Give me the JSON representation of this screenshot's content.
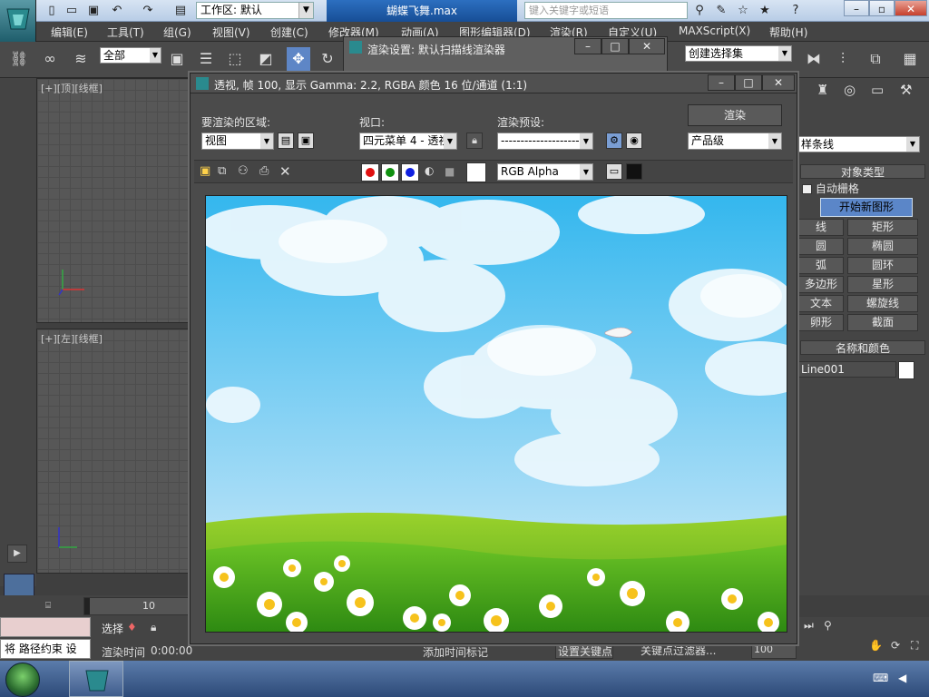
{
  "titlebar": {
    "workspace_label": "工作区: 默认",
    "doc_title": "蝴蝶飞舞.max",
    "search_placeholder": "键入关键字或短语"
  },
  "menu": [
    "编辑(E)",
    "工具(T)",
    "组(G)",
    "视图(V)",
    "创建(C)",
    "修改器(M)",
    "动画(A)",
    "图形编辑器(D)",
    "渲染(R)",
    "自定义(U)",
    "MAXScript(X)",
    "帮助(H)"
  ],
  "toolbar": {
    "selection_filter": "全部",
    "create_selection_set": "创建选择集"
  },
  "viewports": {
    "top": "[+][顶][线框]",
    "left": "[+][左][线框]"
  },
  "render_settings_title": "渲染设置: 默认扫描线渲染器",
  "frame_window": {
    "title": "透视, 帧 100, 显示 Gamma: 2.2, RGBA 颜色 16 位/通道 (1:1)",
    "area_label": "要渲染的区域:",
    "area_value": "视图",
    "viewport_label": "视口:",
    "viewport_value": "四元菜单 4 - 透视",
    "preset_label": "渲染预设:",
    "preset_value": "--------------------",
    "render_button": "渲染",
    "quality_value": "产品级",
    "channel_value": "RGB Alpha",
    "channel_colors": {
      "red": "#e01010",
      "green": "#109010",
      "blue": "#1020e0"
    }
  },
  "cmd_panel": {
    "category": "样条线",
    "object_type_header": "对象类型",
    "autogrid": "自动栅格",
    "start_new_shape": "开始新图形",
    "buttons": [
      "线",
      "矩形",
      "圆",
      "椭圆",
      "弧",
      "圆环",
      "多边形",
      "星形",
      "文本",
      "螺旋线",
      "卵形",
      "截面"
    ],
    "name_color_header": "名称和颜色",
    "object_name": "Line001"
  },
  "status": {
    "prompt": "将 路径约束 设",
    "select_label": "选择",
    "render_time_label": "渲染时间",
    "render_time_value": "0:00:00",
    "add_time_tag": "添加时间标记",
    "set_key": "设置关键点",
    "key_filter": "关键点过滤器...",
    "frame_field": "100",
    "timeline_value": "10"
  }
}
